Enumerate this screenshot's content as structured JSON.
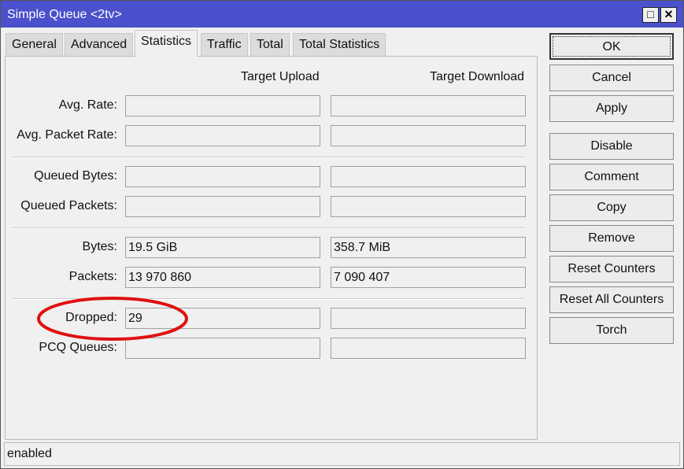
{
  "window": {
    "title": "Simple Queue <2tv>",
    "maximize_icon": "□",
    "close_icon": "✕"
  },
  "tabs": [
    "General",
    "Advanced",
    "Statistics",
    "Traffic",
    "Total",
    "Total Statistics"
  ],
  "active_tab": "Statistics",
  "columns": {
    "upload": "Target Upload",
    "download": "Target Download"
  },
  "rows": [
    {
      "label": "Avg. Rate:",
      "upload": "",
      "download": ""
    },
    {
      "label": "Avg. Packet Rate:",
      "upload": "",
      "download": ""
    },
    {
      "label": "Queued Bytes:",
      "upload": "",
      "download": ""
    },
    {
      "label": "Queued Packets:",
      "upload": "",
      "download": ""
    },
    {
      "label": "Bytes:",
      "upload": "19.5 GiB",
      "download": "358.7 MiB"
    },
    {
      "label": "Packets:",
      "upload": "13 970 860",
      "download": "7 090 407"
    },
    {
      "label": "Dropped:",
      "upload": "29",
      "download": ""
    },
    {
      "label": "PCQ Queues:",
      "upload": "",
      "download": ""
    }
  ],
  "buttons": [
    "OK",
    "Cancel",
    "Apply",
    "Disable",
    "Comment",
    "Copy",
    "Remove",
    "Reset Counters",
    "Reset All Counters",
    "Torch"
  ],
  "status": "enabled",
  "highlight_color": "#e01010"
}
